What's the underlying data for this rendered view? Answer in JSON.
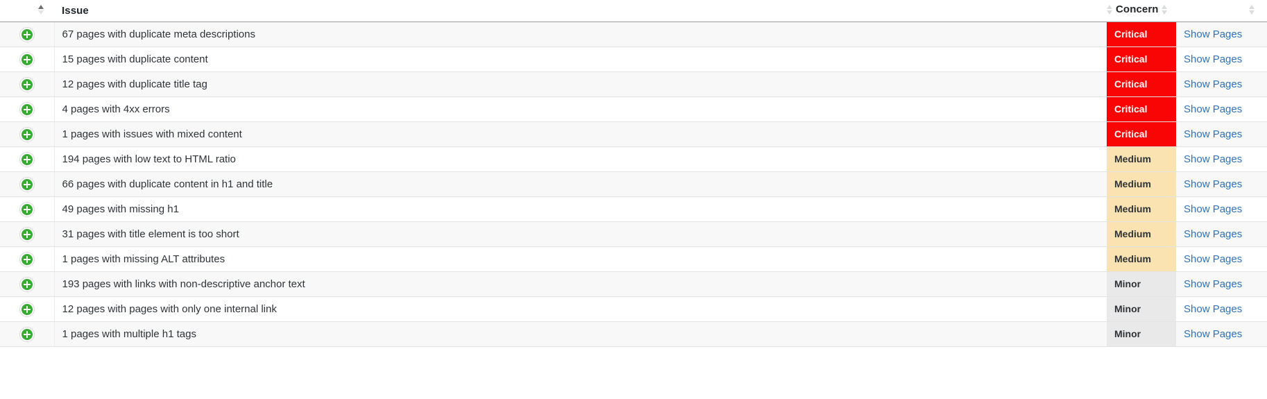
{
  "table": {
    "columns": {
      "expand": {
        "label": "",
        "sorter": "sort-caret-icon",
        "sorted": true
      },
      "issue": {
        "label": "Issue",
        "sorter": "sort-caret-icon",
        "sorted": false
      },
      "concern": {
        "label": "Concern",
        "sorter": "sort-caret-icon",
        "sorted": false
      },
      "action": {
        "label": "",
        "sorter": "sort-caret-icon",
        "sorted": false
      }
    },
    "expand_icon_name": "expand-row-plus-icon",
    "action_label": "Show Pages",
    "concern_colors": {
      "Critical": "#fa0505",
      "Medium": "#fae3b0",
      "Minor": "#e9e9e9"
    },
    "link_color": "#2f72b8",
    "rows": [
      {
        "issue": "67 pages with duplicate meta descriptions",
        "concern": "Critical",
        "concern_class": "concern-critical",
        "action": "Show Pages"
      },
      {
        "issue": "15 pages with duplicate content",
        "concern": "Critical",
        "concern_class": "concern-critical",
        "action": "Show Pages"
      },
      {
        "issue": "12 pages with duplicate title tag",
        "concern": "Critical",
        "concern_class": "concern-critical",
        "action": "Show Pages"
      },
      {
        "issue": "4 pages with 4xx errors",
        "concern": "Critical",
        "concern_class": "concern-critical",
        "action": "Show Pages"
      },
      {
        "issue": "1 pages with issues with mixed content",
        "concern": "Critical",
        "concern_class": "concern-critical",
        "action": "Show Pages"
      },
      {
        "issue": "194 pages with low text to HTML ratio",
        "concern": "Medium",
        "concern_class": "concern-medium",
        "action": "Show Pages"
      },
      {
        "issue": "66 pages with duplicate content in h1 and title",
        "concern": "Medium",
        "concern_class": "concern-medium",
        "action": "Show Pages"
      },
      {
        "issue": "49 pages with missing h1",
        "concern": "Medium",
        "concern_class": "concern-medium",
        "action": "Show Pages"
      },
      {
        "issue": "31 pages with title element is too short",
        "concern": "Medium",
        "concern_class": "concern-medium",
        "action": "Show Pages"
      },
      {
        "issue": "1 pages with missing ALT attributes",
        "concern": "Medium",
        "concern_class": "concern-medium",
        "action": "Show Pages"
      },
      {
        "issue": "193 pages with links with non-descriptive anchor text",
        "concern": "Minor",
        "concern_class": "concern-minor",
        "action": "Show Pages"
      },
      {
        "issue": "12 pages with pages with only one internal link",
        "concern": "Minor",
        "concern_class": "concern-minor",
        "action": "Show Pages"
      },
      {
        "issue": "1 pages with multiple h1 tags",
        "concern": "Minor",
        "concern_class": "concern-minor",
        "action": "Show Pages"
      }
    ]
  }
}
